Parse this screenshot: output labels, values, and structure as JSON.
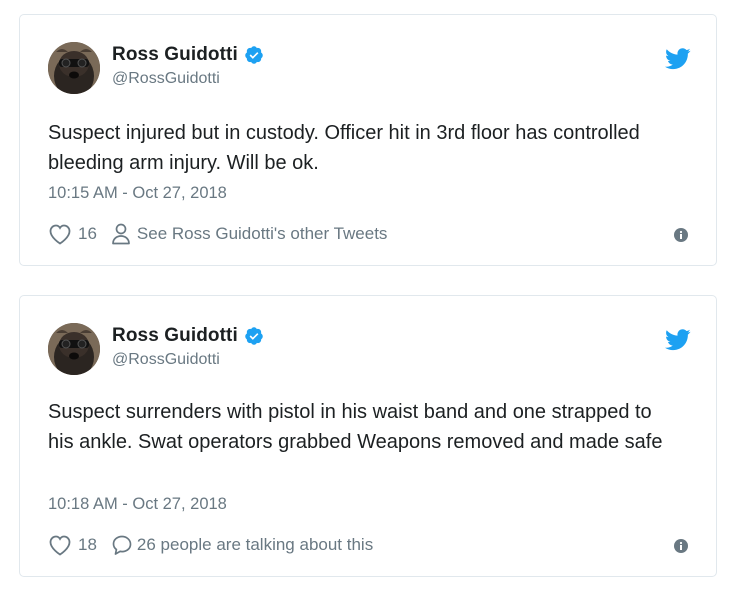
{
  "colors": {
    "twitter_blue": "#1da1f2",
    "text_primary": "#1c2022",
    "text_secondary": "#697882",
    "border": "#e1e8ed"
  },
  "icons": {
    "verified": "verified-badge-icon",
    "brand": "twitter-bird-icon",
    "like": "heart-icon",
    "profile": "person-icon",
    "conversation": "speech-bubble-icon",
    "info": "info-icon"
  },
  "tweets": [
    {
      "author_name": "Ross Guidotti",
      "author_handle": "@RossGuidotti",
      "text": "Suspect injured but in custody. Officer hit in 3rd floor has controlled bleeding arm injury. Will be ok.",
      "timestamp": "10:15 AM - Oct 27, 2018",
      "like_count": "16",
      "secondary_action": "See Ross Guidotti's other Tweets"
    },
    {
      "author_name": "Ross Guidotti",
      "author_handle": "@RossGuidotti",
      "text": "Suspect surrenders with pistol in his waist band and one strapped to his ankle. Swat operators grabbed Weapons removed and made safe",
      "timestamp": "10:18 AM - Oct 27, 2018",
      "like_count": "18",
      "secondary_action": "26 people are talking about this"
    }
  ]
}
